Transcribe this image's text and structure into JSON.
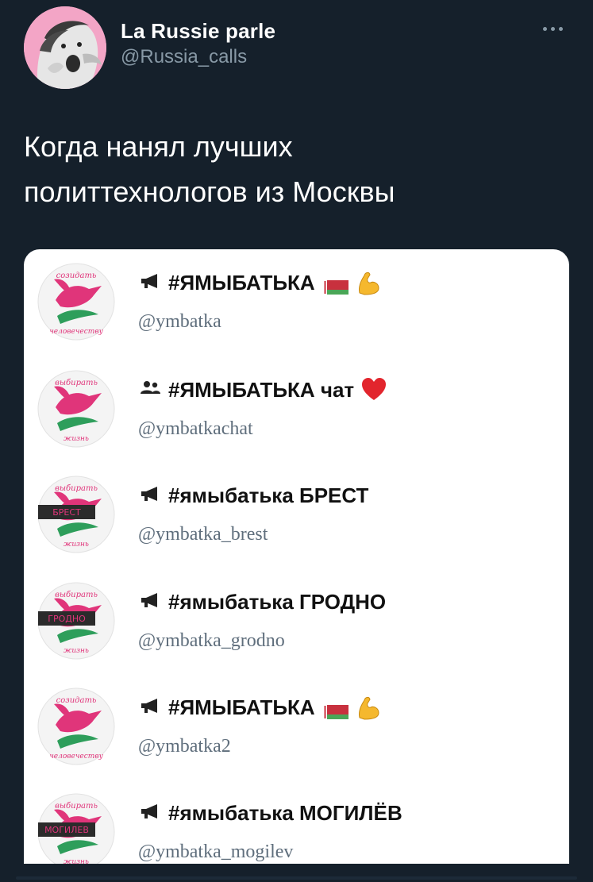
{
  "author": {
    "name": "La Russie parle",
    "handle": "@Russia_calls"
  },
  "tweet": {
    "lines": [
      "Когда нанял лучших",
      "политтехнологов из Москвы"
    ]
  },
  "channels": [
    {
      "type": "channel",
      "title": "#ЯМЫБАТЬКА",
      "handle": "@ymbatka",
      "icon_top": "созидать",
      "icon_bottom": "человечеству",
      "icon_tag": "",
      "emoji": [
        "flag-belarus-icon",
        "flexed-biceps-icon"
      ]
    },
    {
      "type": "group",
      "title": "#ЯМЫБАТЬКА чат",
      "handle": "@ymbatkachat",
      "icon_top": "выбирать",
      "icon_bottom": "жизнь",
      "icon_tag": "",
      "emoji": [
        "red-heart-icon"
      ]
    },
    {
      "type": "channel",
      "title": "#ямыбатька БРЕСТ",
      "handle": "@ymbatka_brest",
      "icon_top": "выбирать",
      "icon_bottom": "жизнь",
      "icon_tag": "БРЕСТ",
      "emoji": []
    },
    {
      "type": "channel",
      "title": "#ямыбатька ГРОДНО",
      "handle": "@ymbatka_grodno",
      "icon_top": "выбирать",
      "icon_bottom": "жизнь",
      "icon_tag": "ГРОДНО",
      "emoji": []
    },
    {
      "type": "channel",
      "title": "#ЯМЫБАТЬКА",
      "handle": "@ymbatka2",
      "icon_top": "созидать",
      "icon_bottom": "человечеству",
      "icon_tag": "",
      "emoji": [
        "flag-belarus-icon",
        "flexed-biceps-icon"
      ]
    },
    {
      "type": "channel",
      "title": "#ямыбатька МОГИЛЁВ",
      "handle": "@ymbatka_mogilev",
      "icon_top": "выбирать",
      "icon_bottom": "жизнь",
      "icon_tag": "МОГИЛЕВ",
      "emoji": []
    }
  ],
  "colors": {
    "background": "#15202b",
    "dove_pink": "#e0357a",
    "green": "#2e9e5b",
    "flag_red": "#c8313e",
    "flag_green": "#4aa657"
  }
}
